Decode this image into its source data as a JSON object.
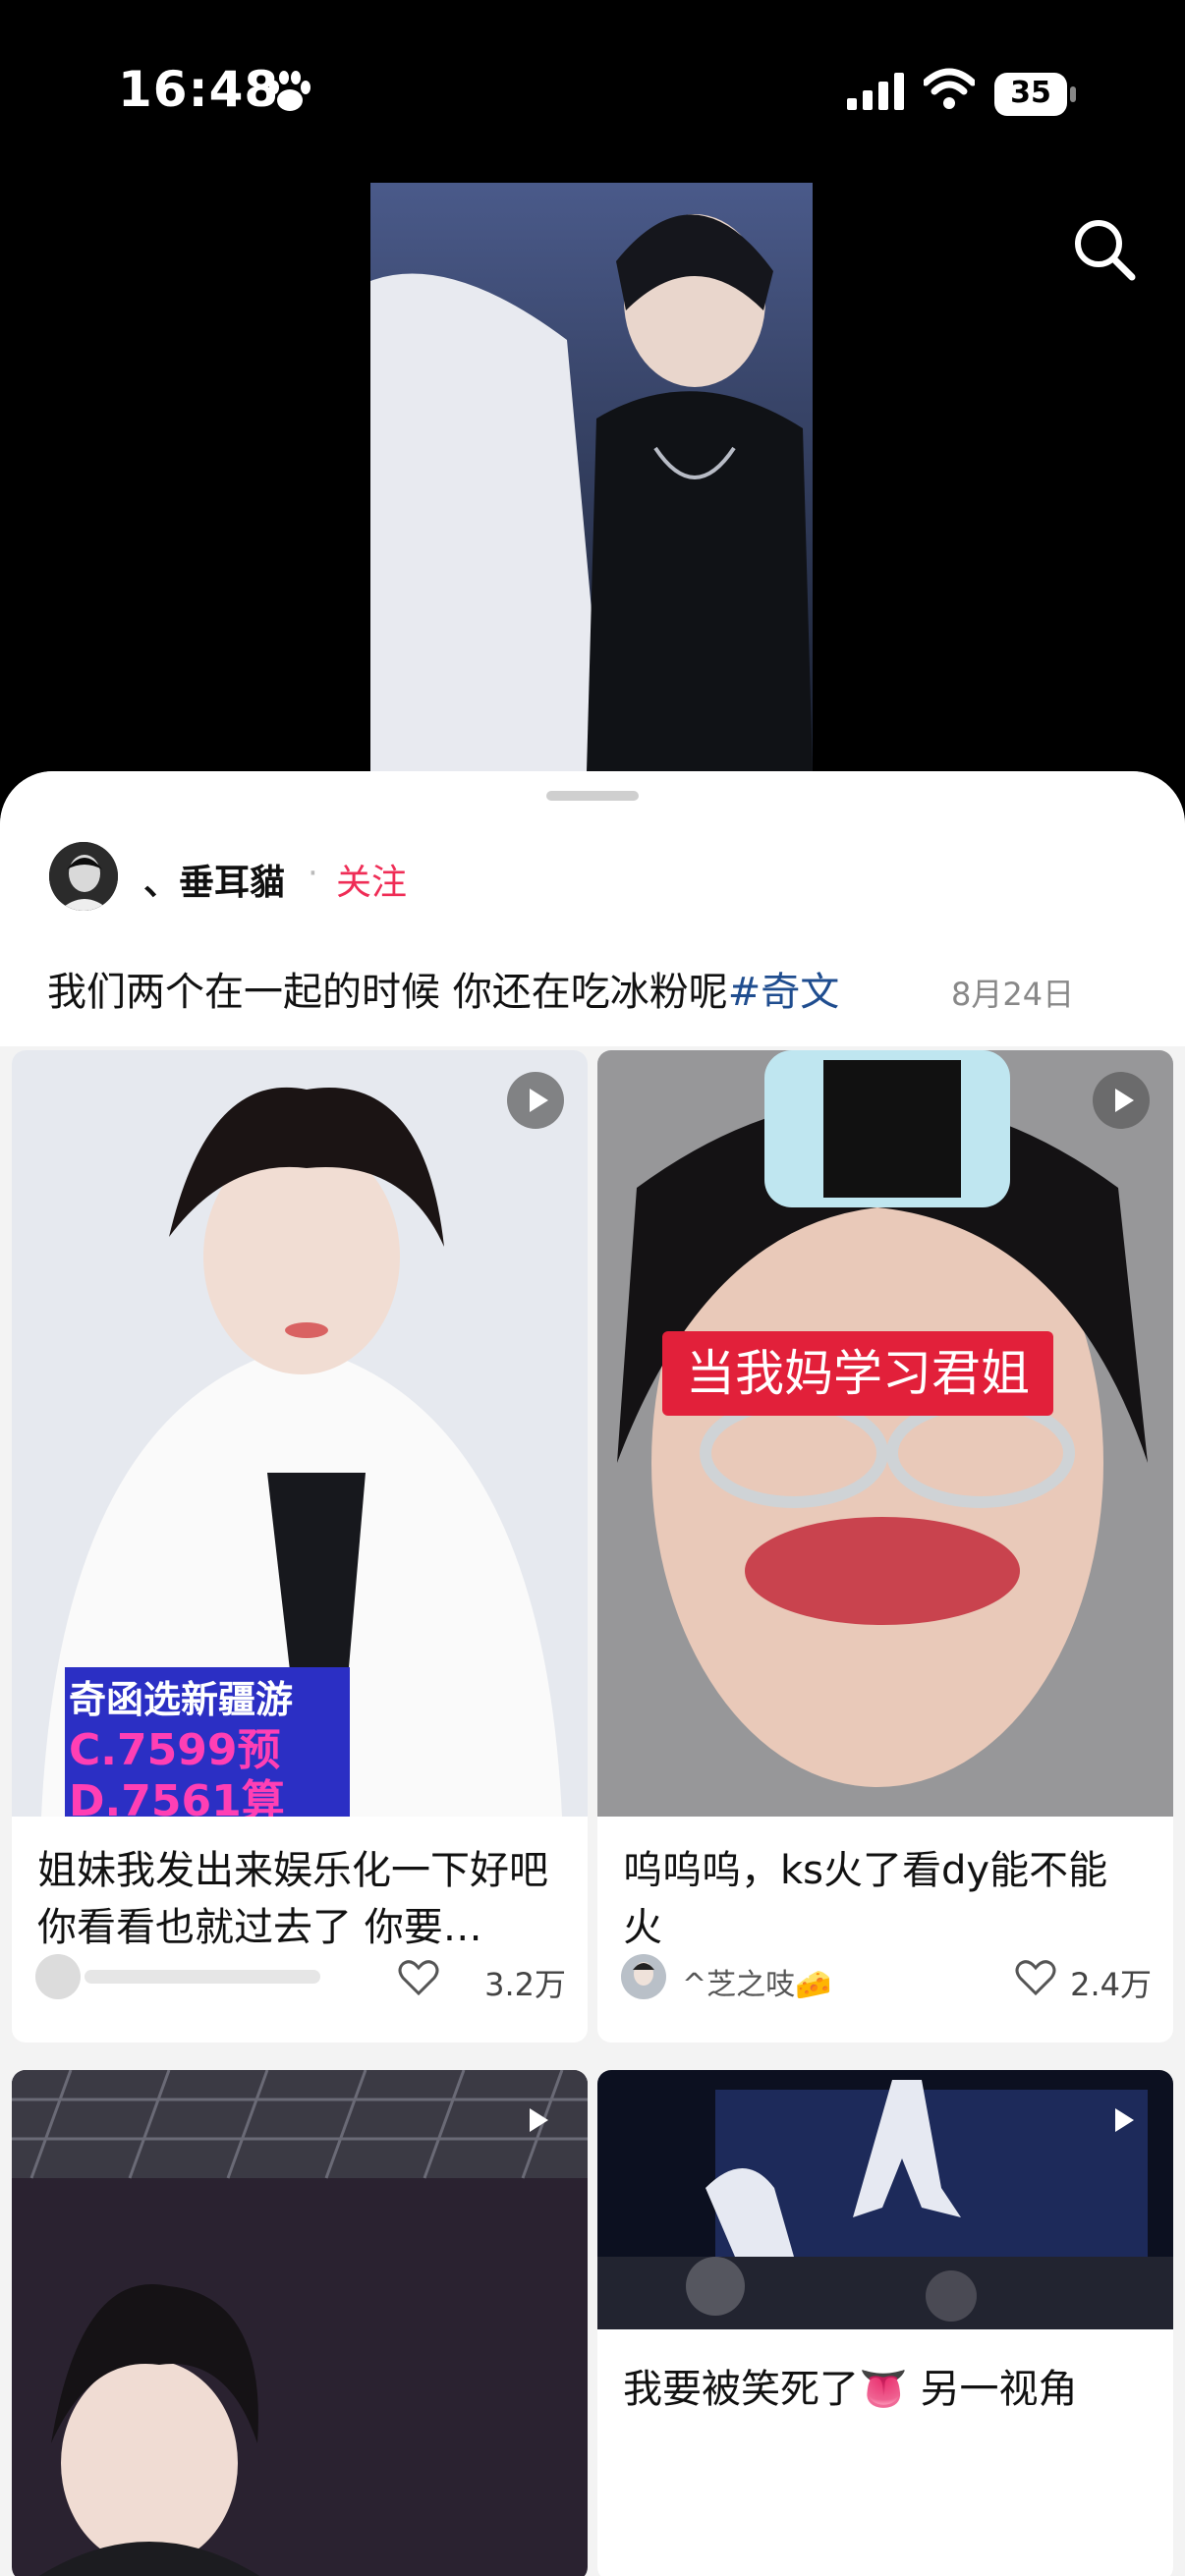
{
  "status_bar": {
    "time": "16:48",
    "battery": "35"
  },
  "post": {
    "author": "、垂耳貓",
    "separator": "·",
    "follow_label": "关注",
    "description": "我们两个在一起的时候 你还在吃冰粉呢",
    "hashtag": "#奇文",
    "date": "8月24日"
  },
  "cards": [
    {
      "overlay_line1": "奇函选新疆游",
      "overlay_line2": "C.7599预",
      "overlay_line3": "D.7561算",
      "title": "姐妹我发出来娱乐化一下好吧 你看看也就过去了 你要…",
      "likes": "3.2万"
    },
    {
      "overlay": "当我妈学习君姐",
      "title": "呜呜呜，ks火了看dy能不能火",
      "username": "^芝之吱🧀",
      "likes": "2.4万"
    },
    {},
    {
      "title": "我要被笑死了👅 另一视角"
    }
  ],
  "colors": {
    "accent": "#ef2d56",
    "hashtag": "#1f4d8f",
    "sheet": "#f3f3f3"
  }
}
